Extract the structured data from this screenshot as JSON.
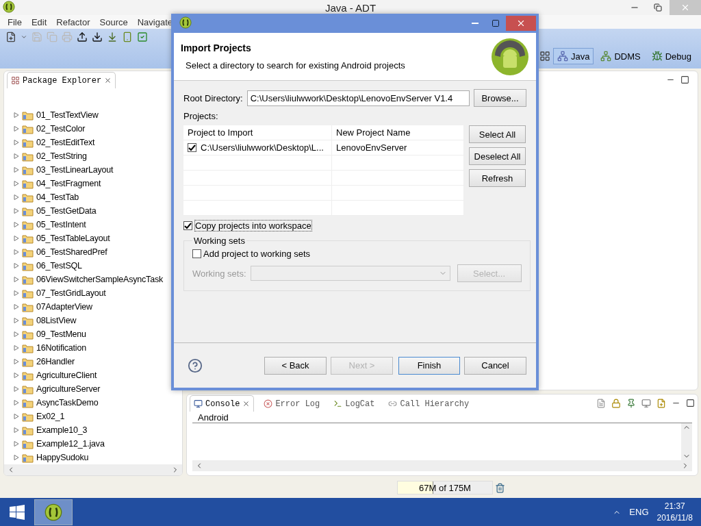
{
  "window": {
    "title": "Java - ADT"
  },
  "menu": [
    "File",
    "Edit",
    "Refactor",
    "Source",
    "Navigate"
  ],
  "perspectives": [
    {
      "label": "Java",
      "selected": true
    },
    {
      "label": "DDMS",
      "selected": false
    },
    {
      "label": "Debug",
      "selected": false
    }
  ],
  "package_explorer": {
    "title": "Package Explorer",
    "items": [
      {
        "label": "01_TestTextView",
        "expanded": false
      },
      {
        "label": "02_TestColor",
        "expanded": false
      },
      {
        "label": "02_TestEditText",
        "expanded": false
      },
      {
        "label": "02_TestString",
        "expanded": false
      },
      {
        "label": "03_TestLinearLayout",
        "expanded": false
      },
      {
        "label": "04_TestFragment",
        "expanded": false
      },
      {
        "label": "04_TestTab",
        "expanded": false
      },
      {
        "label": "05_TestGetData",
        "expanded": false
      },
      {
        "label": "05_TestIntent",
        "expanded": false
      },
      {
        "label": "05_TestTableLayout",
        "expanded": false
      },
      {
        "label": "06_TestSharedPref",
        "expanded": false
      },
      {
        "label": "06_TestSQL",
        "expanded": false
      },
      {
        "label": "06ViewSwitcherSampleAsyncTask",
        "expanded": false
      },
      {
        "label": "07_TestGridLayout",
        "expanded": false
      },
      {
        "label": "07AdapterView",
        "expanded": false
      },
      {
        "label": "08ListView",
        "expanded": false
      },
      {
        "label": "09_TestMenu",
        "expanded": false
      },
      {
        "label": "16Notification",
        "expanded": false
      },
      {
        "label": "26Handler",
        "expanded": false
      },
      {
        "label": "AgricultureClient",
        "expanded": false
      },
      {
        "label": "AgricultureServer",
        "expanded": false
      },
      {
        "label": "AsyncTaskDemo",
        "expanded": false
      },
      {
        "label": "Ex02_1",
        "expanded": false
      },
      {
        "label": "Example10_3",
        "expanded": false
      },
      {
        "label": "Example12_1.java",
        "expanded": false
      },
      {
        "label": "HappySudoku",
        "expanded": false
      }
    ]
  },
  "console": {
    "tabs": [
      {
        "label": "Console",
        "selected": true
      },
      {
        "label": "Error Log",
        "selected": false
      },
      {
        "label": "LogCat",
        "selected": false
      },
      {
        "label": "Call Hierarchy",
        "selected": false
      }
    ],
    "header": "Android"
  },
  "status_bar": {
    "memory": "67M of 175M",
    "level": 0.38
  },
  "dialog": {
    "title": "Import Projects",
    "subtitle": "Select a directory to search for existing Android projects",
    "root_directory": {
      "label": "Root Directory:",
      "value": "C:\\Users\\liulwwork\\Desktop\\LenovoEnvServer V1.4"
    },
    "browse": "Browse...",
    "projects_label": "Projects:",
    "columns": [
      "Project to Import",
      "New Project Name"
    ],
    "rows": [
      {
        "checked": true,
        "project": "C:\\Users\\liulwwork\\Desktop\\L...",
        "name": "LenovoEnvServer"
      }
    ],
    "side_buttons": [
      "Select All",
      "Deselect All",
      "Refresh"
    ],
    "copy": {
      "label": "Copy projects into workspace",
      "checked": true
    },
    "working_sets": {
      "title": "Working sets",
      "add": {
        "label": "Add project to working sets",
        "checked": false
      },
      "label": "Working sets:",
      "select": "Select...",
      "disabled": true
    },
    "buttons": [
      {
        "label": "< Back",
        "disabled": false,
        "default": false
      },
      {
        "label": "Next >",
        "disabled": true,
        "default": false
      },
      {
        "label": "Finish",
        "disabled": false,
        "default": true
      },
      {
        "label": "Cancel",
        "disabled": false,
        "default": false
      }
    ]
  },
  "taskbar": {
    "language": "ENG",
    "time": "21:37",
    "date": "2016/11/8"
  }
}
